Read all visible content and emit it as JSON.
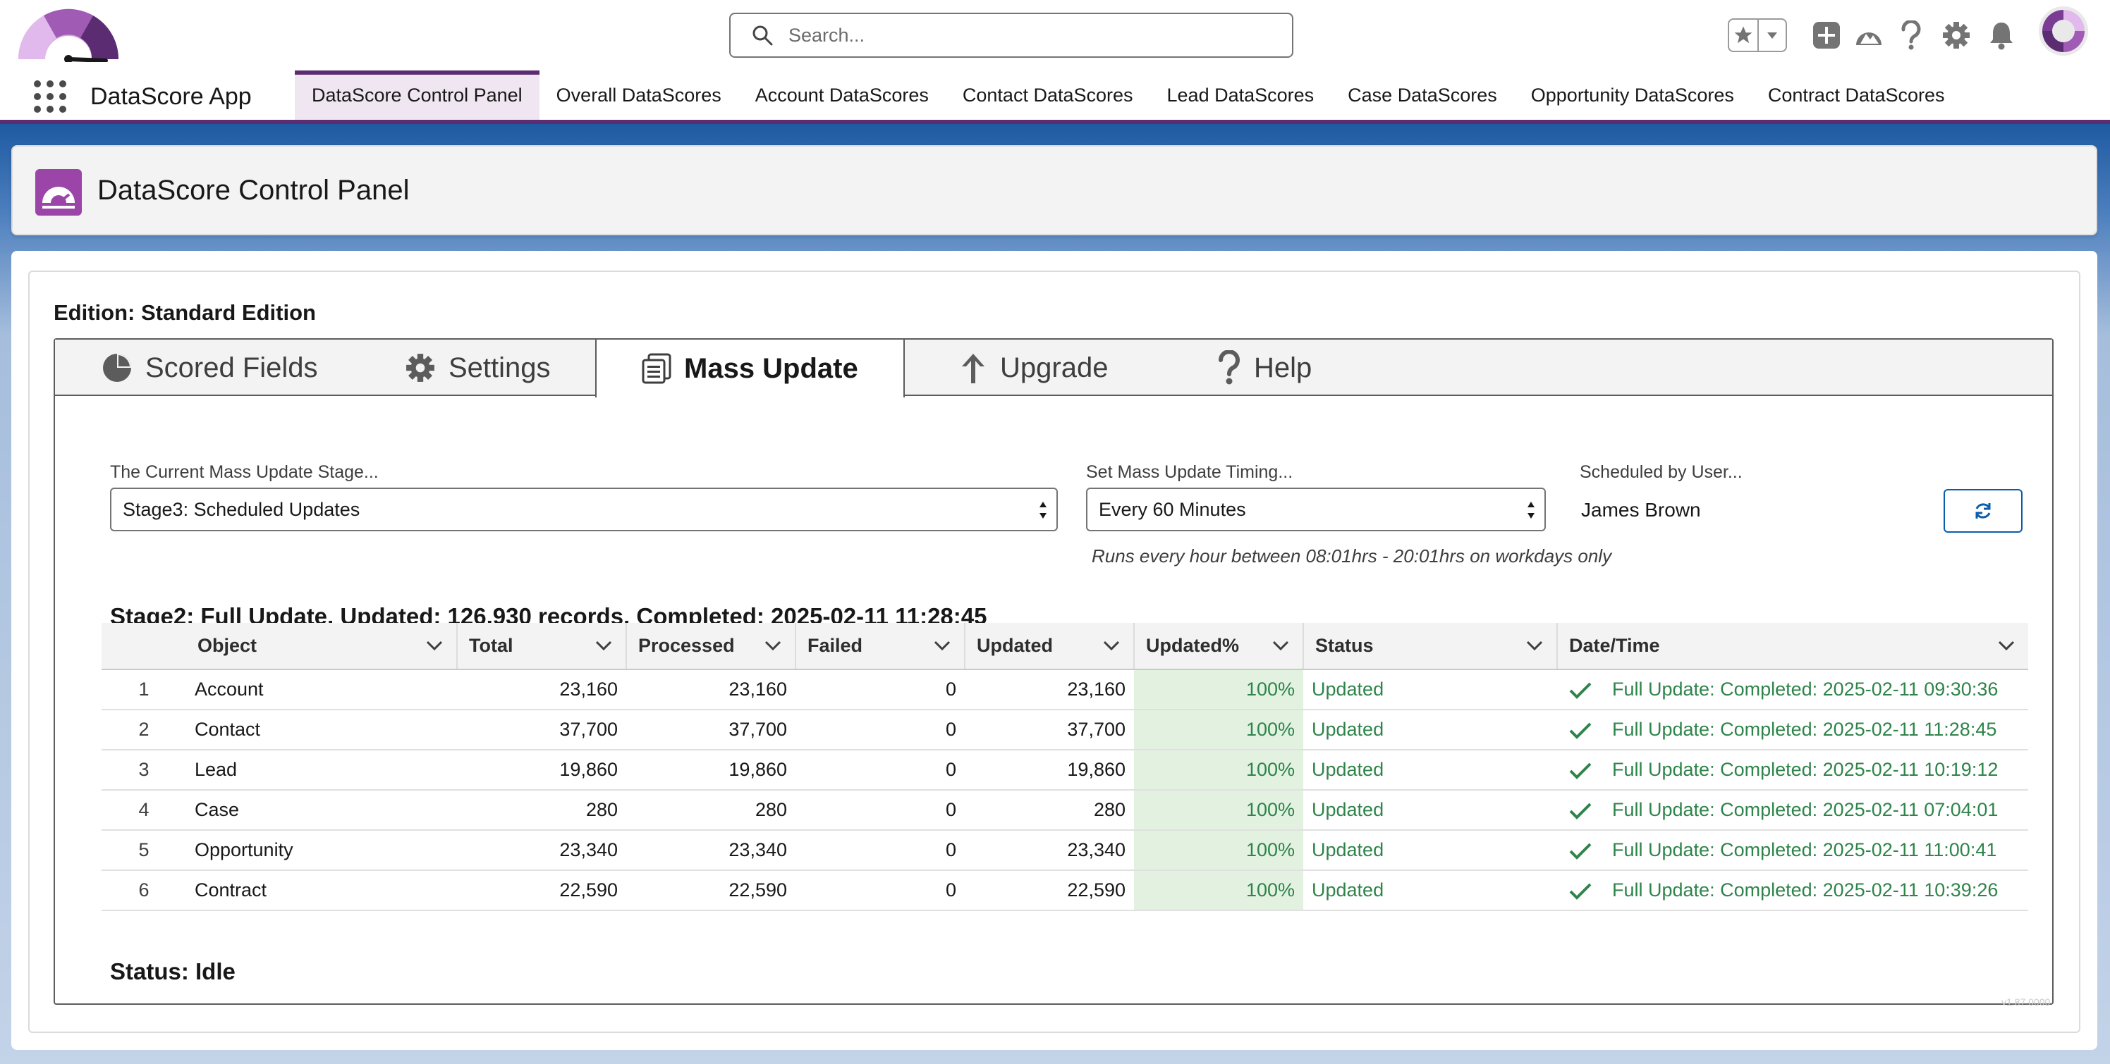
{
  "global_header": {
    "search_placeholder": "Search...",
    "icons": [
      "favorites-star-icon",
      "favorites-dropdown-icon",
      "global-add-icon",
      "trailhead-icon",
      "help-icon",
      "setup-gear-icon",
      "notifications-bell-icon",
      "user-avatar"
    ]
  },
  "app_nav": {
    "app_name": "DataScore App",
    "tabs": [
      {
        "label": "DataScore Control Panel",
        "active": true
      },
      {
        "label": "Overall DataScores"
      },
      {
        "label": "Account DataScores"
      },
      {
        "label": "Contact DataScores"
      },
      {
        "label": "Lead DataScores"
      },
      {
        "label": "Case DataScores"
      },
      {
        "label": "Opportunity DataScores"
      },
      {
        "label": "Contract DataScores"
      }
    ]
  },
  "page_header": {
    "title": "DataScore Control Panel"
  },
  "edition": "Edition: Standard Edition",
  "tabs": [
    {
      "label": "Scored Fields",
      "icon": "pie-chart-icon"
    },
    {
      "label": "Settings",
      "icon": "gear-icon"
    },
    {
      "label": "Mass Update",
      "icon": "documents-icon",
      "active": true
    },
    {
      "label": "Upgrade",
      "icon": "arrow-up-icon"
    },
    {
      "label": "Help",
      "icon": "question-icon"
    }
  ],
  "mass_update": {
    "stage_label": "The Current Mass Update Stage...",
    "stage_value": "Stage3: Scheduled Updates",
    "timing_label": "Set Mass Update Timing...",
    "timing_value": "Every 60 Minutes",
    "timing_note": "Runs every hour between 08:01hrs - 20:01hrs on workdays only",
    "user_label": "Scheduled by User...",
    "user_value": "James Brown",
    "summary": "Stage2: Full Update, Updated: 126,930 records, Completed: 2025-02-11 11:28:45",
    "status": "Status: Idle"
  },
  "table": {
    "columns": [
      "Object",
      "Total",
      "Processed",
      "Failed",
      "Updated",
      "Updated%",
      "Status",
      "Date/Time"
    ],
    "rows": [
      {
        "n": "1",
        "object": "Account",
        "total": "23,160",
        "processed": "23,160",
        "failed": "0",
        "updated": "23,160",
        "pct": "100%",
        "status": "Updated",
        "datetime": "Full Update: Completed: 2025-02-11 09:30:36"
      },
      {
        "n": "2",
        "object": "Contact",
        "total": "37,700",
        "processed": "37,700",
        "failed": "0",
        "updated": "37,700",
        "pct": "100%",
        "status": "Updated",
        "datetime": "Full Update: Completed: 2025-02-11 11:28:45"
      },
      {
        "n": "3",
        "object": "Lead",
        "total": "19,860",
        "processed": "19,860",
        "failed": "0",
        "updated": "19,860",
        "pct": "100%",
        "status": "Updated",
        "datetime": "Full Update: Completed: 2025-02-11 10:19:12"
      },
      {
        "n": "4",
        "object": "Case",
        "total": "280",
        "processed": "280",
        "failed": "0",
        "updated": "280",
        "pct": "100%",
        "status": "Updated",
        "datetime": "Full Update: Completed: 2025-02-11 07:04:01"
      },
      {
        "n": "5",
        "object": "Opportunity",
        "total": "23,340",
        "processed": "23,340",
        "failed": "0",
        "updated": "23,340",
        "pct": "100%",
        "status": "Updated",
        "datetime": "Full Update: Completed: 2025-02-11 11:00:41"
      },
      {
        "n": "6",
        "object": "Contract",
        "total": "22,590",
        "processed": "22,590",
        "failed": "0",
        "updated": "22,590",
        "pct": "100%",
        "status": "Updated",
        "datetime": "Full Update: Completed: 2025-02-11 10:39:26"
      }
    ]
  },
  "version": "v1.87.0000",
  "colors": {
    "brand_purple": "#5b2c72",
    "accent_purple": "#9b45a8",
    "success_green": "#2e844a",
    "pct_background": "#e3f1e1",
    "link_blue": "#0b5cab"
  }
}
